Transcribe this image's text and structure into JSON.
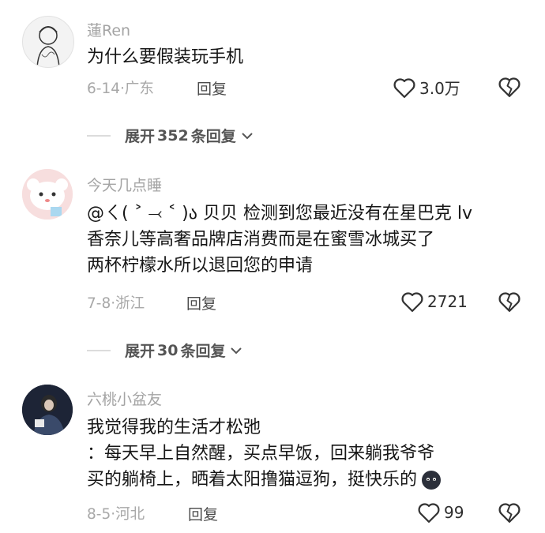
{
  "comments": [
    {
      "username": "蓮Ren",
      "text_lines": [
        "为什么要假装玩手机"
      ],
      "date": "6-14",
      "location": "广东",
      "reply_label": "回复",
      "likes": "3.0万",
      "expand": {
        "prefix": "展开",
        "count": "352",
        "suffix": "条回复"
      }
    },
    {
      "username": "今天几点睡",
      "text_lines": [
        "@ㄑ( ˃ ⤙ ˂ )ა 贝贝 检测到您最近没有在星巴克 lv",
        "香奈儿等高奢品牌店消费而是在蜜雪冰城买了",
        "两杯柠檬水所以退回您的申请"
      ],
      "date": "7-8",
      "location": "浙江",
      "reply_label": "回复",
      "likes": "2721",
      "expand": {
        "prefix": "展开",
        "count": "30",
        "suffix": "条回复"
      }
    },
    {
      "username": "六桃小盆友",
      "text_lines": [
        "我觉得我的生活才松弛",
        "：每天早上自然醒，买点早饭，回来躺我爷爷",
        "买的躺椅上，晒着太阳撸猫逗狗，挺快乐的"
      ],
      "date": "8-5",
      "location": "河北",
      "reply_label": "回复",
      "likes": "99"
    }
  ],
  "separator": "·",
  "icons": {
    "like": "heart-outline-icon",
    "dislike": "broken-heart-icon",
    "expand": "chevron-down-icon",
    "emoji": "dark-blob-emoji-icon"
  },
  "colors": {
    "text": "#161616",
    "meta": "#a8a8a8",
    "username": "#a4a4a4",
    "reply": "#4b4b4b"
  }
}
